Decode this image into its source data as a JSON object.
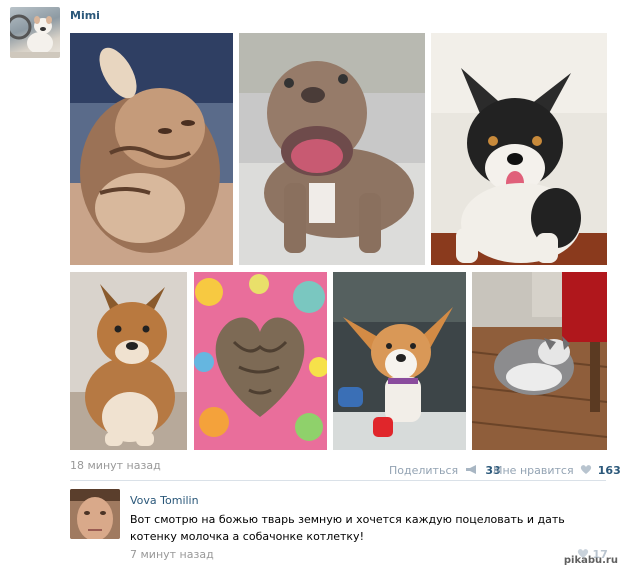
{
  "post": {
    "author": "Mimi",
    "time": "18 минут назад",
    "share_label": "Поделиться",
    "share_count": "33",
    "like_label": "Мне нравится",
    "like_count": "163",
    "photos": [
      {
        "subject": "sleeping-kitten"
      },
      {
        "subject": "smiling-pitbull-puppy"
      },
      {
        "subject": "corgi-puppy-tongue-out"
      },
      {
        "subject": "shiba-inu-puppy"
      },
      {
        "subject": "two-cats-heart-shape"
      },
      {
        "subject": "corgi-puppy-red-toy"
      },
      {
        "subject": "husky-puppy-curled"
      }
    ]
  },
  "comment": {
    "author": "Vova Tomilin",
    "text": "Вот смотрю на божью тварь земную и хочется каждую поцеловать и дать котенку молочка а собачонке котлетку!",
    "time": "7 минут назад",
    "likes": "17"
  },
  "watermark": "pikabu.ru",
  "colors": {
    "link": "#2b587a",
    "muted": "#999999",
    "action": "#93a3b3",
    "divider": "#dae1e8"
  }
}
